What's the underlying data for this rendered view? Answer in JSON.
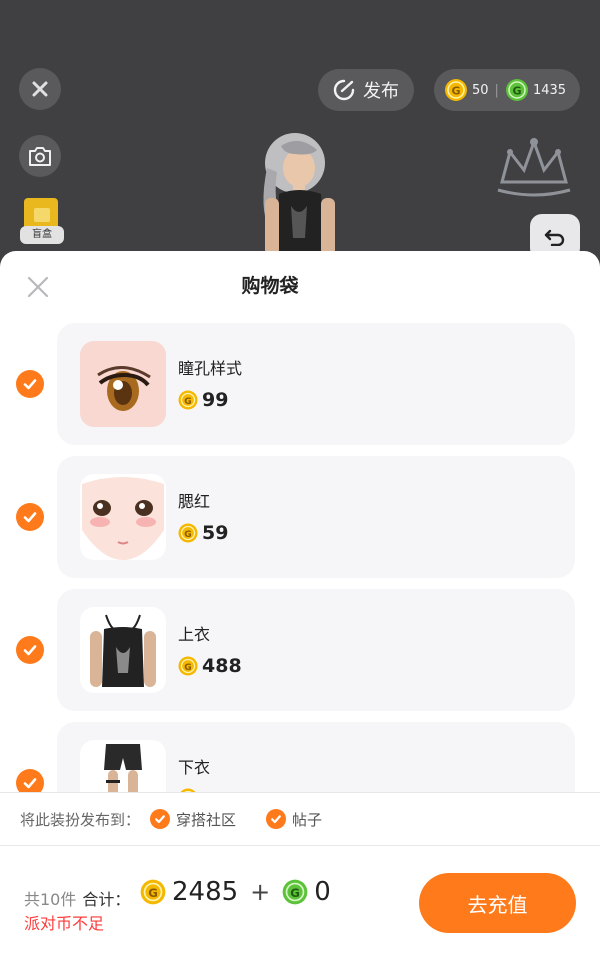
{
  "scene": {
    "publish_label": "发布",
    "gold_amount": "50",
    "green_amount": "1435",
    "blindbox_label": "盲盒",
    "icons": [
      "close-icon",
      "camera-icon",
      "publish-icon",
      "gold-coin-icon",
      "green-coin-icon",
      "undo-icon"
    ]
  },
  "sheet": {
    "title": "购物袋",
    "items": [
      {
        "name": "瞳孔样式",
        "price": "99"
      },
      {
        "name": "腮红",
        "price": "59"
      },
      {
        "name": "上衣",
        "price": "488"
      },
      {
        "name": "下衣",
        "price": ""
      }
    ],
    "publish_prompt": "将此装扮发布到：",
    "publish_targets": [
      "穿搭社区",
      "帖子"
    ]
  },
  "footer": {
    "count": "共10件",
    "sum_label": "合计：",
    "gold_total": "2485",
    "plus": "+",
    "green_total": "0",
    "warning": "派对币不足",
    "recharge_label": "去充值"
  },
  "colors": {
    "accent": "#ff7a1a",
    "warning": "#ff3b3b",
    "gold_coin": "#f5b800",
    "green_coin": "#5cc23a"
  }
}
